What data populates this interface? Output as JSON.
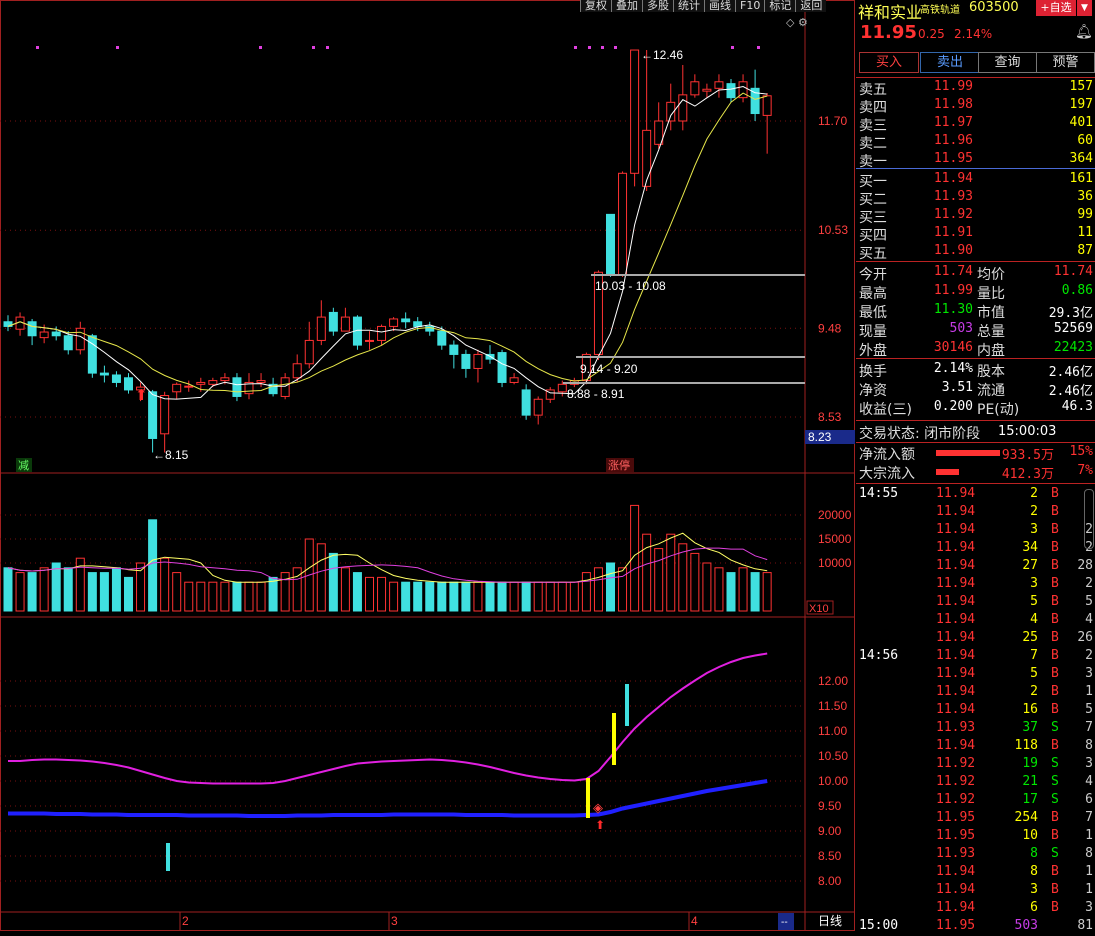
{
  "stock": {
    "name": "祥和实业",
    "tag": "高铁轨道",
    "code": "603500",
    "price": "11.95",
    "change": "0.25",
    "pct": "2.14%",
    "add_label": "+自选"
  },
  "toolbar": [
    "复权",
    "叠加",
    "多股",
    "统计",
    "画线",
    "F10",
    "标记",
    "返回"
  ],
  "actions": {
    "buy": "买入",
    "sell": "卖出",
    "query": "查询",
    "alert": "预警"
  },
  "asks": [
    {
      "label": "卖五",
      "price": "11.99",
      "vol": "157"
    },
    {
      "label": "卖四",
      "price": "11.98",
      "vol": "197"
    },
    {
      "label": "卖三",
      "price": "11.97",
      "vol": "401"
    },
    {
      "label": "卖二",
      "price": "11.96",
      "vol": "60"
    },
    {
      "label": "卖一",
      "price": "11.95",
      "vol": "364"
    }
  ],
  "bids": [
    {
      "label": "买一",
      "price": "11.94",
      "vol": "161"
    },
    {
      "label": "买二",
      "price": "11.93",
      "vol": "36"
    },
    {
      "label": "买三",
      "price": "11.92",
      "vol": "99"
    },
    {
      "label": "买四",
      "price": "11.91",
      "vol": "11"
    },
    {
      "label": "买五",
      "price": "11.90",
      "vol": "87"
    }
  ],
  "stats_left": [
    {
      "label": "今开",
      "value": "11.74",
      "cls": "red"
    },
    {
      "label": "最高",
      "value": "11.99",
      "cls": "red"
    },
    {
      "label": "最低",
      "value": "11.30",
      "cls": "green"
    },
    {
      "label": "现量",
      "value": "503",
      "cls": "purple"
    },
    {
      "label": "外盘",
      "value": "30146",
      "cls": "red"
    }
  ],
  "stats_right": [
    {
      "label": "均价",
      "value": "11.74",
      "cls": "red"
    },
    {
      "label": "量比",
      "value": "0.86",
      "cls": "green"
    },
    {
      "label": "市值",
      "value": "29.3亿",
      "cls": "white"
    },
    {
      "label": "总量",
      "value": "52569",
      "cls": "white"
    },
    {
      "label": "内盘",
      "value": "22423",
      "cls": "green"
    }
  ],
  "stats2": [
    {
      "l1": "换手",
      "v1": "2.14%",
      "l2": "股本",
      "v2": "2.46亿"
    },
    {
      "l1": "净资",
      "v1": "3.51",
      "l2": "流通",
      "v2": "2.46亿"
    },
    {
      "l1": "收益(三)",
      "v1": "0.200",
      "l2": "PE(动)",
      "v2": "46.3"
    }
  ],
  "status": {
    "label": "交易状态: 闭市阶段",
    "time": "15:00:03"
  },
  "flows": [
    {
      "label": "净流入额",
      "value": "933.5万",
      "pct": "15%",
      "bar": 0.85
    },
    {
      "label": "大宗流入",
      "value": "412.3万",
      "pct": "7%",
      "bar": 0.3
    }
  ],
  "ticks": [
    {
      "time": "14:55",
      "price": "11.94",
      "vol": "2",
      "side": "B",
      "n": ""
    },
    {
      "time": "",
      "price": "11.94",
      "vol": "2",
      "side": "B",
      "n": ""
    },
    {
      "time": "",
      "price": "11.94",
      "vol": "3",
      "side": "B",
      "n": "2"
    },
    {
      "time": "",
      "price": "11.94",
      "vol": "34",
      "side": "B",
      "n": "2"
    },
    {
      "time": "",
      "price": "11.94",
      "vol": "27",
      "side": "B",
      "n": "28"
    },
    {
      "time": "",
      "price": "11.94",
      "vol": "3",
      "side": "B",
      "n": "2"
    },
    {
      "time": "",
      "price": "11.94",
      "vol": "5",
      "side": "B",
      "n": "5"
    },
    {
      "time": "",
      "price": "11.94",
      "vol": "4",
      "side": "B",
      "n": "4"
    },
    {
      "time": "",
      "price": "11.94",
      "vol": "25",
      "side": "B",
      "n": "26"
    },
    {
      "time": "14:56",
      "price": "11.94",
      "vol": "7",
      "side": "B",
      "n": "2"
    },
    {
      "time": "",
      "price": "11.94",
      "vol": "5",
      "side": "B",
      "n": "3"
    },
    {
      "time": "",
      "price": "11.94",
      "vol": "2",
      "side": "B",
      "n": "1"
    },
    {
      "time": "",
      "price": "11.94",
      "vol": "16",
      "side": "B",
      "n": "5"
    },
    {
      "time": "",
      "price": "11.93",
      "vol": "37",
      "side": "S",
      "n": "7"
    },
    {
      "time": "",
      "price": "11.94",
      "vol": "118",
      "side": "B",
      "n": "8"
    },
    {
      "time": "",
      "price": "11.92",
      "vol": "19",
      "side": "S",
      "n": "3"
    },
    {
      "time": "",
      "price": "11.92",
      "vol": "21",
      "side": "S",
      "n": "4"
    },
    {
      "time": "",
      "price": "11.92",
      "vol": "17",
      "side": "S",
      "n": "6"
    },
    {
      "time": "",
      "price": "11.95",
      "vol": "254",
      "side": "B",
      "n": "7"
    },
    {
      "time": "",
      "price": "11.95",
      "vol": "10",
      "side": "B",
      "n": "1"
    },
    {
      "time": "",
      "price": "11.93",
      "vol": "8",
      "side": "S",
      "n": "8"
    },
    {
      "time": "",
      "price": "11.94",
      "vol": "8",
      "side": "B",
      "n": "1"
    },
    {
      "time": "",
      "price": "11.94",
      "vol": "3",
      "side": "B",
      "n": "1"
    },
    {
      "time": "",
      "price": "11.94",
      "vol": "6",
      "side": "B",
      "n": "3"
    },
    {
      "time": "15:00",
      "price": "11.95",
      "vol": "503",
      "side": "",
      "n": "81"
    }
  ],
  "chart_data": {
    "type": "candlestick",
    "price_ticks": [
      "11.70",
      "10.53",
      "9.48",
      "8.53"
    ],
    "current_marker": "8.23",
    "annotations": {
      "high": "12.46",
      "low": "8.15",
      "zone1": "10.03 - 10.08",
      "zone2": "9.14 - 9.20",
      "zone3": "8.88 - 8.91",
      "tag_left": "减",
      "tag_right": "涨停"
    },
    "volume_ticks": [
      "20000",
      "15000",
      "10000"
    ],
    "volume_unit": "X10",
    "indicator_ticks": [
      "12.00",
      "11.50",
      "11.00",
      "10.50",
      "10.00",
      "9.50",
      "9.00",
      "8.50",
      "8.00"
    ],
    "x_labels": [
      "2",
      "3",
      "4"
    ],
    "period_label": "日线",
    "scroll_label": "--",
    "candles": [
      [
        9.55,
        9.5,
        9.62,
        9.45
      ],
      [
        9.47,
        9.6,
        9.65,
        9.4
      ],
      [
        9.55,
        9.4,
        9.58,
        9.3
      ],
      [
        9.38,
        9.44,
        9.52,
        9.32
      ],
      [
        9.44,
        9.4,
        9.5,
        9.35
      ],
      [
        9.4,
        9.25,
        9.45,
        9.2
      ],
      [
        9.25,
        9.48,
        9.55,
        9.2
      ],
      [
        9.4,
        9.0,
        9.42,
        8.95
      ],
      [
        9.0,
        8.98,
        9.08,
        8.9
      ],
      [
        8.98,
        8.9,
        9.02,
        8.85
      ],
      [
        8.95,
        8.82,
        9.0,
        8.78
      ],
      [
        8.82,
        8.85,
        8.9,
        8.7
      ],
      [
        8.8,
        8.3,
        8.82,
        8.15
      ],
      [
        8.35,
        8.76,
        8.8,
        8.15
      ],
      [
        8.8,
        8.88,
        8.9,
        8.72
      ],
      [
        8.85,
        8.86,
        8.92,
        8.8
      ],
      [
        8.88,
        8.9,
        8.95,
        8.8
      ],
      [
        8.88,
        8.92,
        8.95,
        8.85
      ],
      [
        8.92,
        8.95,
        9.0,
        8.88
      ],
      [
        8.95,
        8.75,
        9.0,
        8.7
      ],
      [
        8.78,
        8.9,
        9.0,
        8.72
      ],
      [
        8.9,
        8.92,
        9.0,
        8.85
      ],
      [
        8.88,
        8.78,
        8.95,
        8.75
      ],
      [
        8.75,
        8.95,
        9.0,
        8.72
      ],
      [
        8.95,
        9.1,
        9.2,
        8.9
      ],
      [
        9.1,
        9.35,
        9.55,
        9.05
      ],
      [
        9.35,
        9.6,
        9.78,
        9.3
      ],
      [
        9.65,
        9.45,
        9.7,
        9.4
      ],
      [
        9.45,
        9.6,
        9.7,
        9.45
      ],
      [
        9.6,
        9.3,
        9.62,
        9.25
      ],
      [
        9.35,
        9.35,
        9.45,
        9.25
      ],
      [
        9.35,
        9.5,
        9.52,
        9.3
      ],
      [
        9.5,
        9.58,
        9.6,
        9.45
      ],
      [
        9.58,
        9.55,
        9.65,
        9.48
      ],
      [
        9.55,
        9.5,
        9.6,
        9.45
      ],
      [
        9.5,
        9.45,
        9.55,
        9.4
      ],
      [
        9.45,
        9.3,
        9.5,
        9.25
      ],
      [
        9.3,
        9.2,
        9.35,
        9.05
      ],
      [
        9.2,
        9.05,
        9.25,
        8.95
      ],
      [
        9.05,
        9.2,
        9.25,
        8.9
      ],
      [
        9.2,
        9.15,
        9.3,
        9.1
      ],
      [
        9.22,
        8.9,
        9.25,
        8.85
      ],
      [
        8.9,
        8.95,
        9.0,
        8.88
      ],
      [
        8.82,
        8.55,
        8.88,
        8.5
      ],
      [
        8.55,
        8.72,
        8.75,
        8.45
      ],
      [
        8.72,
        8.82,
        8.85,
        8.68
      ],
      [
        8.8,
        8.88,
        8.92,
        8.75
      ],
      [
        8.88,
        8.92,
        8.95,
        8.85
      ],
      [
        8.92,
        9.2,
        9.22,
        8.88
      ],
      [
        9.2,
        10.08,
        10.1,
        9.14
      ],
      [
        10.7,
        10.05,
        10.7,
        10.03
      ],
      [
        10.05,
        11.14,
        11.16,
        10.03
      ],
      [
        11.14,
        12.46,
        12.46,
        11.0
      ],
      [
        11.0,
        11.6,
        12.46,
        10.95
      ],
      [
        11.45,
        11.7,
        11.9,
        11.4
      ],
      [
        11.7,
        11.9,
        12.1,
        11.6
      ],
      [
        11.7,
        11.98,
        12.3,
        11.6
      ],
      [
        11.98,
        12.12,
        12.2,
        11.95
      ],
      [
        12.02,
        12.04,
        12.1,
        11.95
      ],
      [
        12.05,
        12.12,
        12.2,
        11.95
      ],
      [
        12.1,
        11.95,
        12.15,
        11.9
      ],
      [
        11.95,
        12.12,
        12.2,
        11.9
      ],
      [
        12.05,
        11.78,
        12.25,
        11.7
      ],
      [
        11.76,
        11.97,
        12.0,
        11.35
      ]
    ],
    "volumes": [
      9,
      8,
      8,
      9,
      10,
      9,
      11,
      8,
      8,
      9,
      7,
      10,
      19,
      11,
      8,
      6,
      6,
      6,
      6,
      6,
      6,
      6,
      7,
      8,
      9,
      15,
      14,
      12,
      9,
      8,
      7,
      7,
      6,
      6,
      6,
      6,
      6,
      6,
      6,
      6,
      6,
      6,
      6,
      6,
      6,
      6,
      6,
      6,
      8,
      9,
      10,
      9,
      22,
      16,
      13,
      16,
      14,
      12,
      10,
      9,
      8,
      9,
      8,
      8
    ]
  }
}
